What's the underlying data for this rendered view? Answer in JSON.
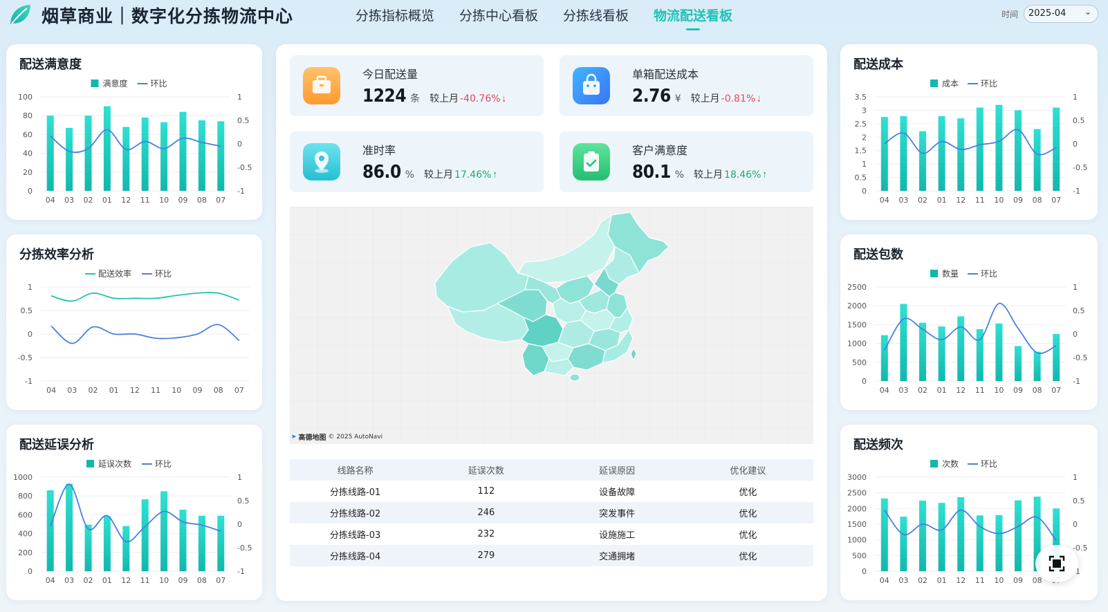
{
  "header": {
    "title": "烟草商业｜数字化分拣物流中心",
    "nav": [
      {
        "label": "分拣指标概览",
        "active": false
      },
      {
        "label": "分拣中心看板",
        "active": false
      },
      {
        "label": "分拣线看板",
        "active": false
      },
      {
        "label": "物流配送看板",
        "active": true
      }
    ],
    "time_label": "时间",
    "time_value": "2025-04"
  },
  "kpis": [
    {
      "title": "今日配送量",
      "value": "1224",
      "unit": "条",
      "compare_label": "较上月",
      "compare": "-40.76%",
      "trend": "down",
      "icon": "briefcase-icon"
    },
    {
      "title": "单箱配送成本",
      "value": "2.76",
      "unit": "¥",
      "compare_label": "较上月",
      "compare": "-0.81%",
      "trend": "down",
      "icon": "shopping-bag-icon"
    },
    {
      "title": "准时率",
      "value": "86.0",
      "unit": "%",
      "compare_label": "较上月",
      "compare": "17.46%",
      "trend": "up",
      "icon": "location-pin-icon"
    },
    {
      "title": "客户满意度",
      "value": "80.1",
      "unit": "%",
      "compare_label": "较上月",
      "compare": "18.46%",
      "trend": "up",
      "icon": "clipboard-check-icon"
    }
  ],
  "map": {
    "brand": "高德地图",
    "copyright": "© 2025 AutoNavi"
  },
  "table": {
    "headers": [
      "线路名称",
      "延误次数",
      "延误原因",
      "优化建议"
    ],
    "rows": [
      [
        "分拣线路-01",
        "112",
        "设备故障",
        "优化"
      ],
      [
        "分拣线路-02",
        "246",
        "突发事件",
        "优化"
      ],
      [
        "分拣线路-03",
        "232",
        "设施施工",
        "优化"
      ],
      [
        "分拣线路-04",
        "279",
        "交通拥堵",
        "优化"
      ]
    ]
  },
  "colors": {
    "accent": "#1fc3b5",
    "bar_top": "#2fe0d2",
    "bar_bottom": "#12b8ad",
    "line": "#4a7fe0",
    "down": "#e3485a",
    "up": "#1faa6a"
  },
  "chart_data": [
    {
      "id": "satisfaction",
      "title": "配送满意度",
      "type": "bar",
      "categories": [
        "04",
        "03",
        "02",
        "01",
        "12",
        "11",
        "10",
        "09",
        "08",
        "07"
      ],
      "series": [
        {
          "name": "满意度",
          "type": "bar",
          "axis": "left",
          "values": [
            80,
            67,
            80,
            90,
            68,
            78,
            73,
            84,
            75,
            74
          ]
        },
        {
          "name": "环比",
          "type": "line",
          "axis": "right",
          "values": [
            0.17,
            -0.16,
            -0.1,
            0.3,
            -0.12,
            0.05,
            -0.1,
            0.12,
            0.03,
            -0.05
          ]
        }
      ],
      "ylim": [
        0,
        100
      ],
      "yticks": [
        0,
        20,
        40,
        60,
        80,
        100
      ],
      "y2lim": [
        -1,
        1
      ],
      "y2ticks": [
        "1",
        "0.5",
        "0",
        "-0.5",
        "-1"
      ],
      "legend": "top-center"
    },
    {
      "id": "efficiency",
      "title": "分拣效率分析",
      "type": "line",
      "categories": [
        "04",
        "03",
        "02",
        "01",
        "12",
        "11",
        "10",
        "09",
        "08",
        "07"
      ],
      "series": [
        {
          "name": "配送效率",
          "type": "line",
          "color": "teal",
          "values": [
            0.81,
            0.7,
            0.87,
            0.76,
            0.76,
            0.76,
            0.82,
            0.87,
            0.87,
            0.72
          ]
        },
        {
          "name": "环比",
          "type": "line",
          "color": "blue",
          "values": [
            0.17,
            -0.2,
            0.15,
            0.0,
            0.0,
            -0.09,
            -0.08,
            0.0,
            0.2,
            -0.14
          ]
        }
      ],
      "ylim": [
        -1,
        1
      ],
      "yticks": [
        "1",
        "0.5",
        "0",
        "-0.5",
        "-1"
      ],
      "legend": "top-center"
    },
    {
      "id": "delay",
      "title": "配送延误分析",
      "type": "bar",
      "categories": [
        "04",
        "03",
        "02",
        "01",
        "12",
        "11",
        "10",
        "09",
        "08",
        "07"
      ],
      "series": [
        {
          "name": "延误次数",
          "type": "bar",
          "axis": "left",
          "values": [
            860,
            930,
            495,
            585,
            480,
            765,
            850,
            655,
            590,
            590
          ]
        },
        {
          "name": "环比",
          "type": "line",
          "axis": "right",
          "values": [
            -0.05,
            0.85,
            -0.1,
            0.18,
            -0.37,
            -0.05,
            0.27,
            0.05,
            -0.02,
            -0.15
          ]
        }
      ],
      "ylim": [
        0,
        1000
      ],
      "yticks": [
        0,
        200,
        400,
        600,
        800,
        1000
      ],
      "y2lim": [
        -1,
        1
      ],
      "y2ticks": [
        "1",
        "0.5",
        "0",
        "-0.5",
        "-1"
      ],
      "legend": "top-center"
    },
    {
      "id": "cost",
      "title": "配送成本",
      "type": "bar",
      "categories": [
        "04",
        "03",
        "02",
        "01",
        "12",
        "11",
        "10",
        "09",
        "08",
        "07"
      ],
      "series": [
        {
          "name": "成本",
          "type": "bar",
          "axis": "left",
          "values": [
            2.75,
            2.78,
            2.22,
            2.78,
            2.7,
            3.1,
            3.2,
            3.0,
            2.3,
            3.1
          ]
        },
        {
          "name": "环比",
          "type": "line",
          "axis": "right",
          "values": [
            0.0,
            0.23,
            -0.2,
            0.05,
            -0.12,
            -0.02,
            0.05,
            0.3,
            -0.22,
            -0.08
          ]
        }
      ],
      "ylim": [
        0,
        3.5
      ],
      "yticks": [
        "0",
        "0.5",
        "1",
        "1.5",
        "2",
        "2.5",
        "3",
        "3.5"
      ],
      "y2lim": [
        -1,
        1
      ],
      "y2ticks": [
        "1",
        "0.5",
        "0",
        "-0.5",
        "-1"
      ],
      "legend": "top-center"
    },
    {
      "id": "packages",
      "title": "配送包数",
      "type": "bar",
      "categories": [
        "04",
        "03",
        "02",
        "01",
        "12",
        "11",
        "10",
        "09",
        "08",
        "07"
      ],
      "series": [
        {
          "name": "数量",
          "type": "bar",
          "axis": "left",
          "values": [
            1220,
            2050,
            1550,
            1450,
            1720,
            1380,
            1530,
            930,
            780,
            1250
          ]
        },
        {
          "name": "环比",
          "type": "line",
          "axis": "right",
          "values": [
            -0.35,
            0.32,
            0.1,
            -0.12,
            0.15,
            -0.12,
            0.65,
            0.12,
            -0.4,
            -0.25
          ]
        }
      ],
      "ylim": [
        0,
        2500
      ],
      "yticks": [
        0,
        500,
        1000,
        1500,
        2000,
        2500
      ],
      "y2lim": [
        -1,
        1
      ],
      "y2ticks": [
        "1",
        "0.5",
        "0",
        "-0.5",
        "-1"
      ],
      "legend": "top-center"
    },
    {
      "id": "frequency",
      "title": "配送频次",
      "type": "bar",
      "categories": [
        "04",
        "03",
        "02",
        "01",
        "12",
        "11",
        "10",
        "09",
        "08",
        "07"
      ],
      "series": [
        {
          "name": "次数",
          "type": "bar",
          "axis": "left",
          "values": [
            2320,
            1740,
            2250,
            2180,
            2360,
            1780,
            1790,
            2260,
            2380,
            2000
          ]
        },
        {
          "name": "环比",
          "type": "line",
          "axis": "right",
          "values": [
            0.3,
            -0.22,
            0.0,
            -0.12,
            0.3,
            -0.05,
            -0.2,
            -0.05,
            0.15,
            -0.35
          ]
        }
      ],
      "ylim": [
        0,
        3000
      ],
      "yticks": [
        0,
        500,
        1000,
        1500,
        2000,
        2500,
        3000
      ],
      "y2lim": [
        -1,
        1
      ],
      "y2ticks": [
        "1",
        "0.5",
        "0",
        "-0.5",
        "-1"
      ],
      "legend": "top-center"
    }
  ]
}
